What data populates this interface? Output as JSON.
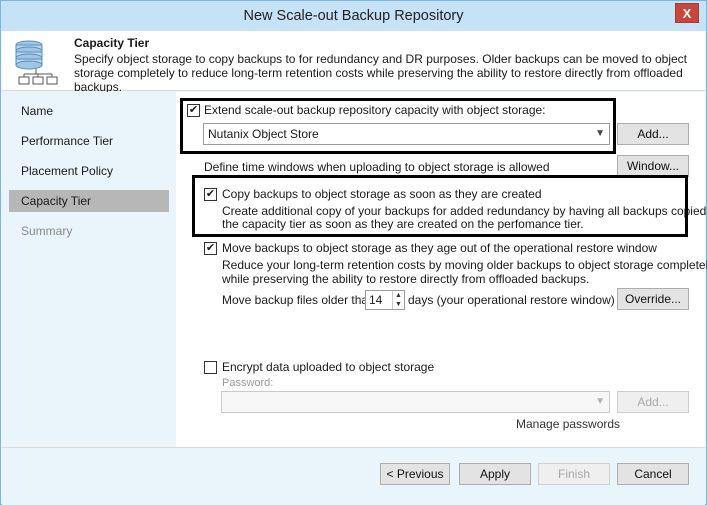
{
  "window": {
    "title": "New Scale-out Backup Repository",
    "close_glyph": "X"
  },
  "header": {
    "icon": "repository-icon",
    "title": "Capacity Tier",
    "description": "Specify object storage to copy backups to for redundancy and DR purposes. Older backups can be moved to object storage completely to reduce long-term retention costs while preserving the ability to restore directly from offloaded backups."
  },
  "sidebar": {
    "items": [
      {
        "label": "Name"
      },
      {
        "label": "Performance Tier"
      },
      {
        "label": "Placement Policy"
      },
      {
        "label": "Capacity Tier"
      },
      {
        "label": "Summary"
      }
    ],
    "active_index": 3
  },
  "main": {
    "extend_checkbox": {
      "label": "Extend scale-out backup repository capacity with object storage:",
      "checked": true
    },
    "object_store_select": {
      "value": "Nutanix Object Store"
    },
    "add_button": "Add...",
    "time_windows_label": "Define time windows when uploading to object storage is allowed",
    "window_button": "Window...",
    "copy_checkbox": {
      "label": "Copy backups to object storage as soon as they are created",
      "desc_line1": "Create additional copy of your backups for added redundancy by having all backups copied to",
      "desc_line2": "the capacity tier as soon as they are created on the perfomance tier.",
      "checked": true
    },
    "move_checkbox": {
      "label": "Move backups to object storage as they age out of the operational restore window",
      "desc_line1": "Reduce your long-term retention costs by moving older backups to object storage completely",
      "desc_line2": "while preserving the ability to restore directly from offloaded backups.",
      "checked": true
    },
    "move_older_label": "Move backup files older than",
    "move_older_days": "14",
    "days_label": "days (your operational restore window)",
    "override_button": "Override...",
    "encrypt_checkbox": {
      "label": "Encrypt data uploaded to object storage",
      "checked": false
    },
    "password_label": "Password:",
    "password_select": {
      "value": ""
    },
    "password_add_button": "Add...",
    "manage_passwords": "Manage passwords"
  },
  "footer": {
    "previous_button": "< Previous",
    "apply_button": "Apply",
    "finish_button": "Finish",
    "cancel_button": "Cancel"
  },
  "colors": {
    "window_bg": "#eaf4fb",
    "titlebar": "#c5e2f6",
    "close": "#c8463d",
    "active_nav": "#b7b7b7"
  }
}
